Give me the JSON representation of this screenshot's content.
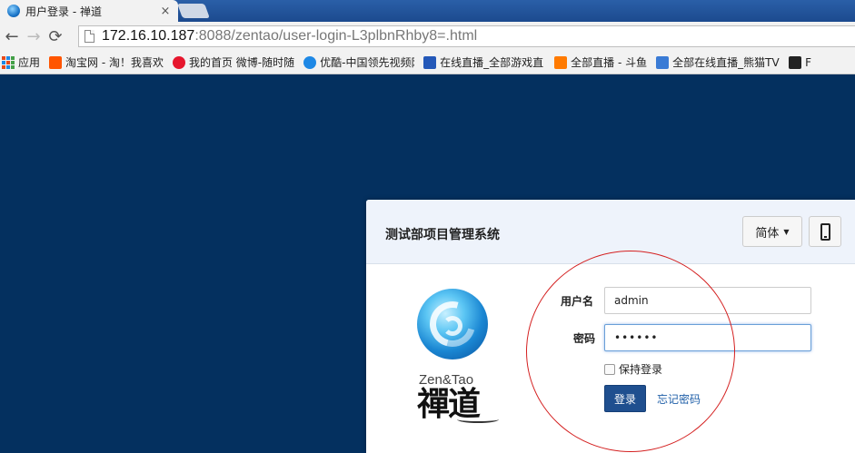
{
  "browser": {
    "tab_title": "用户登录 - 禅道",
    "tab_close": "×",
    "url_host": "172.16.10.187",
    "url_rest": ":8088/zentao/user-login-L3plbnRhby8=.html"
  },
  "bookmarks": [
    {
      "label": "应用"
    },
    {
      "label": "淘宝网 - 淘！我喜欢",
      "color": "#ff5500"
    },
    {
      "label": "我的首页 微博-随时随",
      "color": "#e6162d"
    },
    {
      "label": "优酷-中国领先视频网",
      "color": "#1e88e5"
    },
    {
      "label": "在线直播_全部游戏直",
      "color": "#2458b8"
    },
    {
      "label": "全部直播 - 斗鱼",
      "color": "#ff7a00"
    },
    {
      "label": "全部在线直播_熊猫TV",
      "color": "#3a7bd5"
    },
    {
      "label": "F",
      "color": "#222222"
    }
  ],
  "panel": {
    "system_title": "测试部项目管理系统",
    "lang_label": "简体",
    "username_label": "用户名",
    "username_value": "admin",
    "password_label": "密码",
    "password_value": "••••••",
    "remember_label": "保持登录",
    "login_label": "登录",
    "forgot_label": "忘记密码",
    "brand_en": "Zen&Tao",
    "brand_cn": "禪道"
  },
  "colors": {
    "page_background": "#04305f",
    "primary_button": "#1f4f8f",
    "annotation_circle": "#d42020"
  }
}
